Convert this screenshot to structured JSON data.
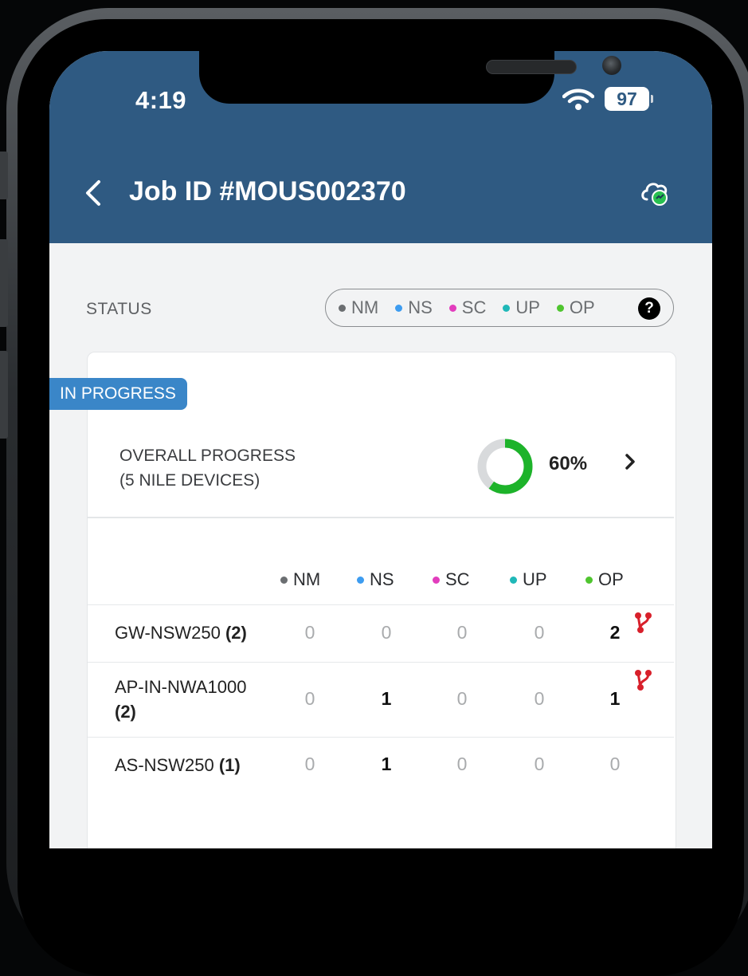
{
  "status_bar": {
    "time": "4:19",
    "battery": "97"
  },
  "header": {
    "title": "Job ID #MOUS002370"
  },
  "status": {
    "label": "STATUS",
    "legend": [
      {
        "code": "NM",
        "color": "#6b6e71"
      },
      {
        "code": "NS",
        "color": "#3d9cf0"
      },
      {
        "code": "SC",
        "color": "#e23dbd"
      },
      {
        "code": "UP",
        "color": "#1fb8b8"
      },
      {
        "code": "OP",
        "color": "#4fc52f"
      }
    ],
    "help": "?"
  },
  "card": {
    "badge": "IN PROGRESS",
    "overall_line1": "OVERALL PROGRESS",
    "overall_line2": "(5 NILE DEVICES)",
    "progress_text": "60%",
    "progress_fraction": 0.6,
    "progress_color": "#1db32a",
    "track_color": "#d8dadc"
  },
  "table": {
    "columns": [
      "NM",
      "NS",
      "SC",
      "UP",
      "OP"
    ],
    "rows": [
      {
        "name": "GW-NSW250",
        "count": "(2)",
        "values": [
          "0",
          "0",
          "0",
          "0",
          "2"
        ]
      },
      {
        "name": "AP-IN-NWA1000",
        "count": "(2)",
        "values": [
          "0",
          "1",
          "0",
          "0",
          "1"
        ]
      },
      {
        "name": "AS-NSW250",
        "count": "(1)",
        "values": [
          "0",
          "1",
          "0",
          "0",
          "0"
        ]
      }
    ]
  }
}
